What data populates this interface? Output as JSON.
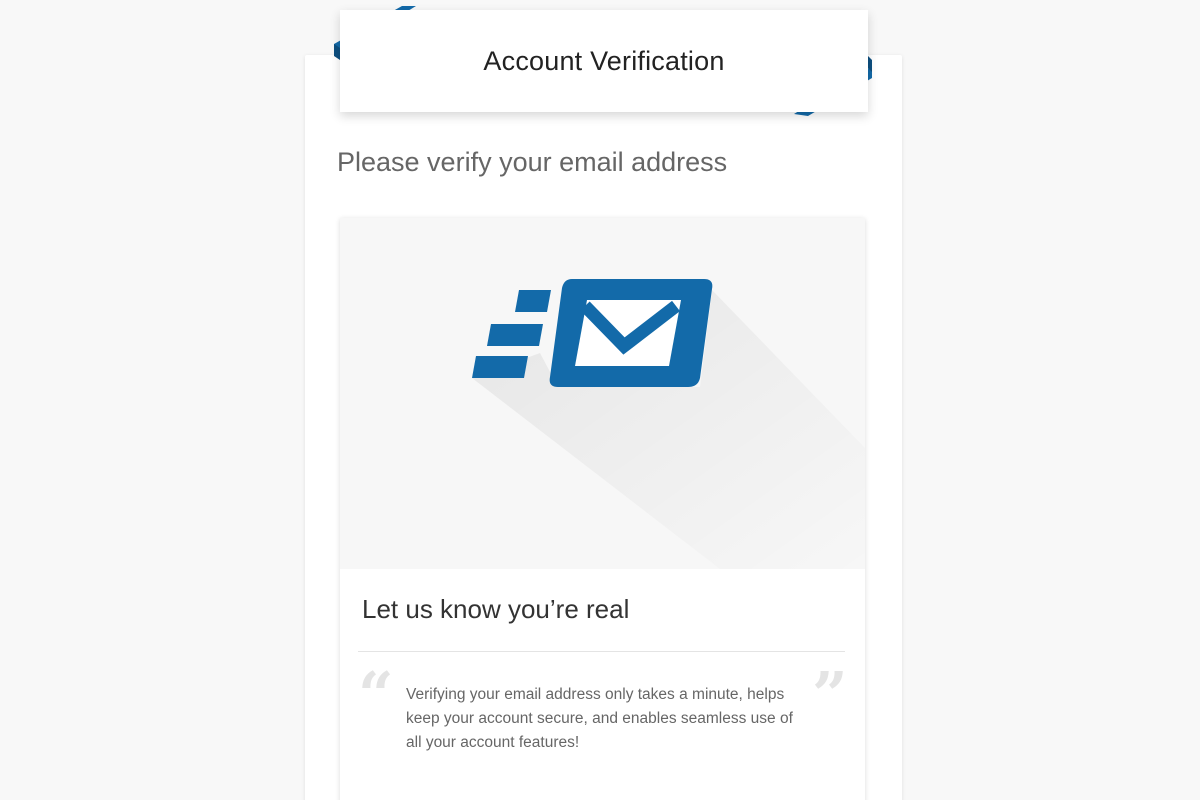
{
  "header": {
    "title": "Account Verification"
  },
  "main": {
    "heading": "Please verify your email address"
  },
  "card": {
    "illustration_icon": "email-send-icon",
    "title": "Let us know you’re real",
    "quote_open": "“",
    "quote_close": "”",
    "body": "Verifying your email address only takes a minute, helps keep your account secure, and enables seamless use of all your account features!"
  },
  "colors": {
    "brand_blue": "#136aa9",
    "background": "#f8f8f8",
    "card": "#ffffff",
    "hero_background": "#f7f7f7"
  }
}
